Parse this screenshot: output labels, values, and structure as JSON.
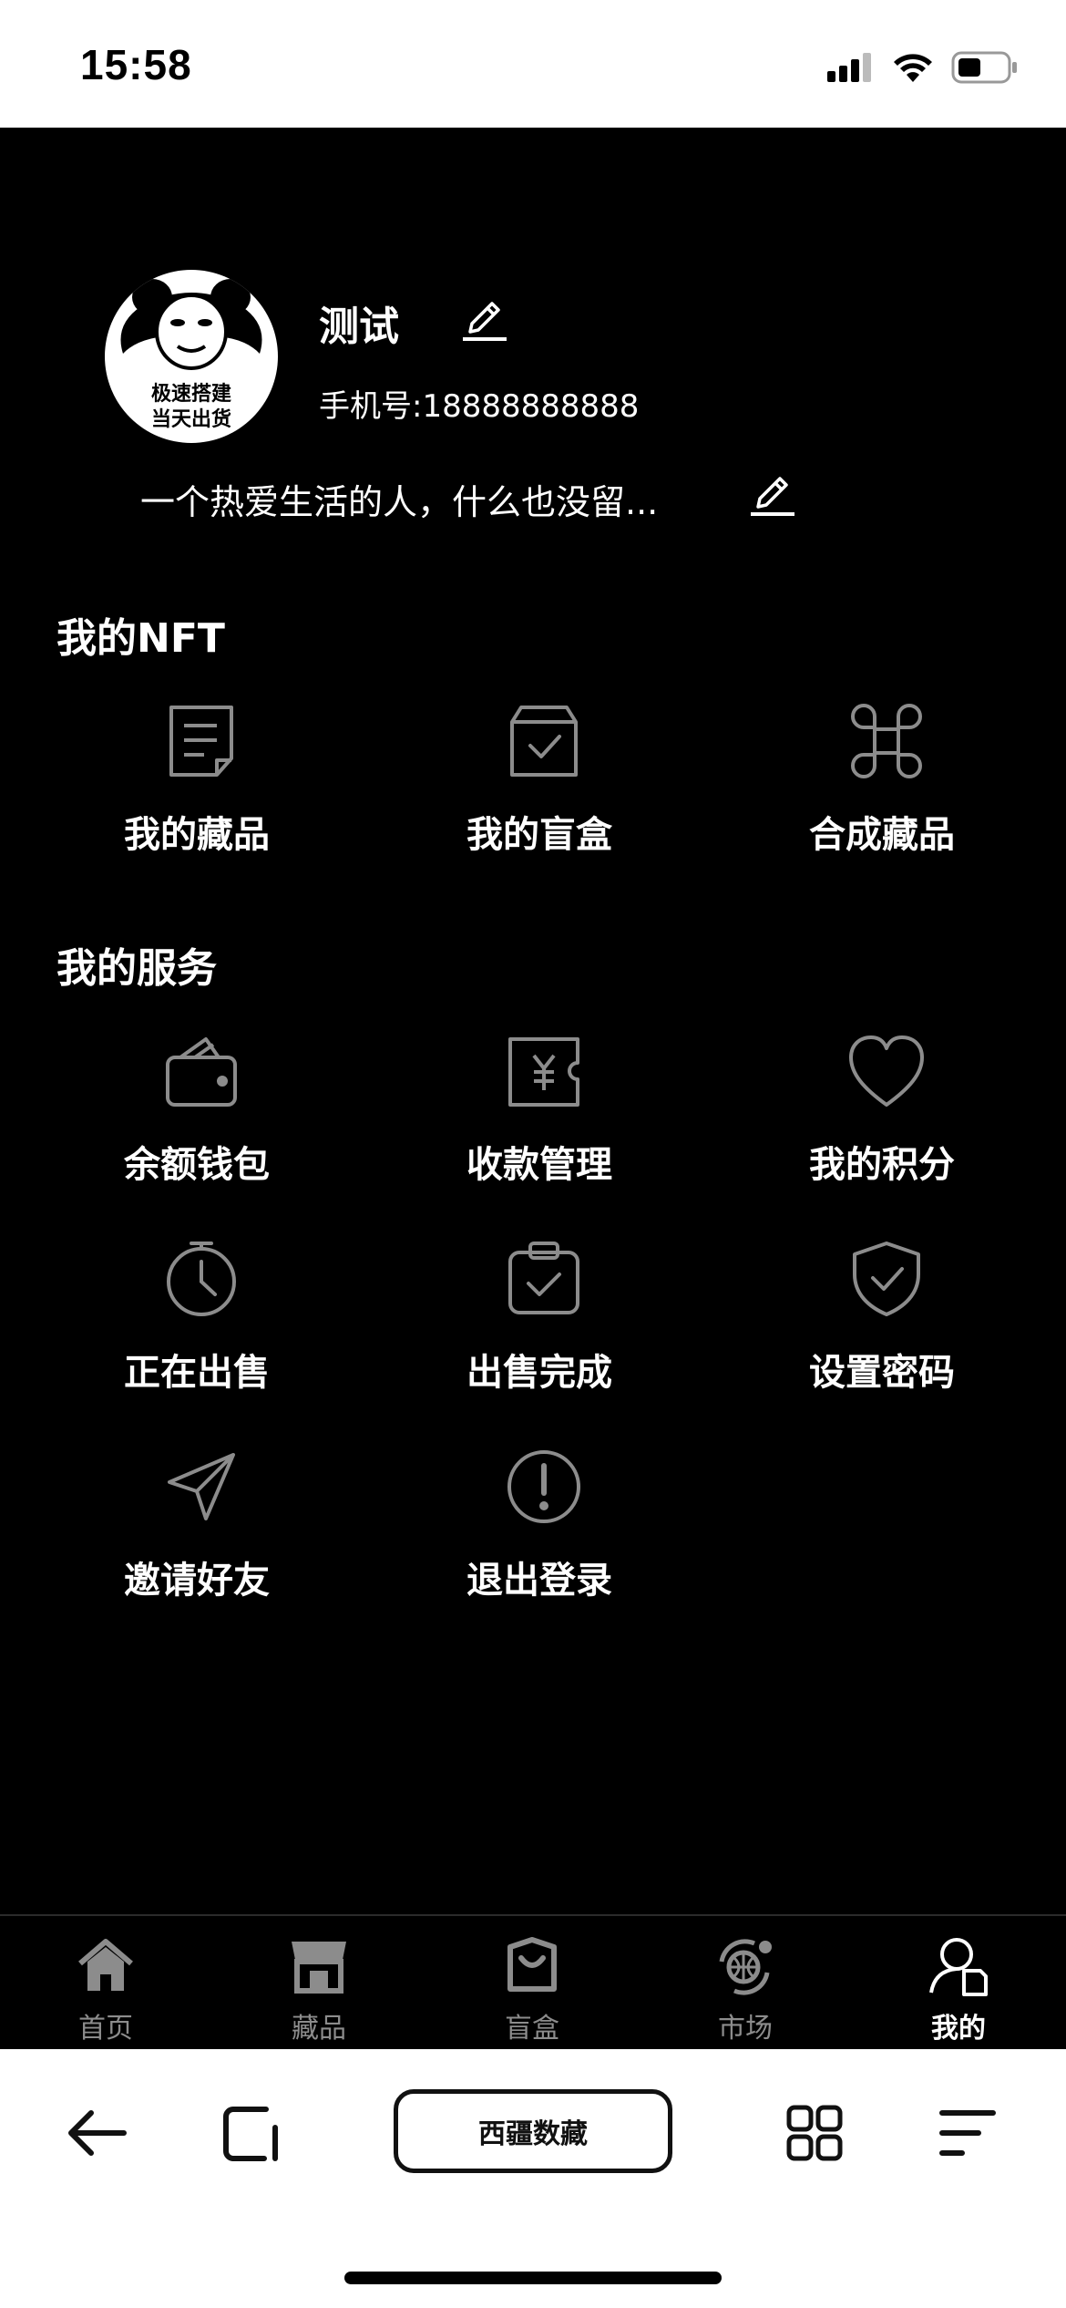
{
  "status_bar": {
    "time": "15:58"
  },
  "profile": {
    "avatar_caption_line1": "极速搭建",
    "avatar_caption_line2": "当天出货",
    "name": "测试",
    "phone": "手机号:18888888888",
    "bio": "一个热爱生活的人，什么也没留..."
  },
  "nft_section": {
    "title": "我的NFT",
    "items": [
      {
        "label": "我的藏品",
        "icon": "document-icon"
      },
      {
        "label": "我的盲盒",
        "icon": "box-check-icon"
      },
      {
        "label": "合成藏品",
        "icon": "command-icon"
      }
    ]
  },
  "service_section": {
    "title": "我的服务",
    "items": [
      {
        "label": "余额钱包",
        "icon": "wallet-icon"
      },
      {
        "label": "收款管理",
        "icon": "yuan-ticket-icon"
      },
      {
        "label": "我的积分",
        "icon": "heart-icon"
      },
      {
        "label": "正在出售",
        "icon": "stopwatch-icon"
      },
      {
        "label": "出售完成",
        "icon": "clipboard-check-icon"
      },
      {
        "label": "设置密码",
        "icon": "shield-check-icon"
      },
      {
        "label": "邀请好友",
        "icon": "send-icon"
      },
      {
        "label": "退出登录",
        "icon": "alert-circle-icon"
      }
    ]
  },
  "tab_bar": {
    "tabs": [
      {
        "label": "首页",
        "icon": "home-icon",
        "active": false
      },
      {
        "label": "藏品",
        "icon": "shop-icon",
        "active": false
      },
      {
        "label": "盲盒",
        "icon": "bag-icon",
        "active": false
      },
      {
        "label": "市场",
        "icon": "market-icon",
        "active": false
      },
      {
        "label": "我的",
        "icon": "user-icon",
        "active": true
      }
    ]
  },
  "browser_bar": {
    "address": "西疆数藏"
  },
  "colors": {
    "background": "#000000",
    "text": "#ffffff",
    "icon_gray": "#8c8c8c",
    "inactive_tab": "#8c8c8c"
  }
}
